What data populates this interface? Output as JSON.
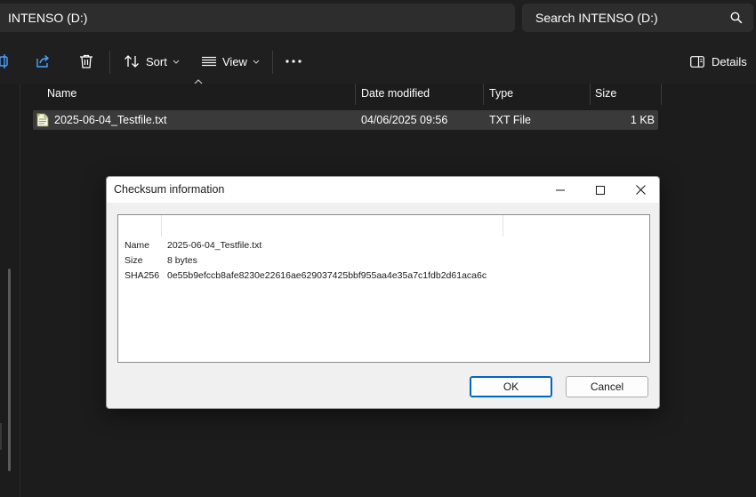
{
  "address": {
    "path": "INTENSO (D:)"
  },
  "search": {
    "placeholder": "Search INTENSO (D:)"
  },
  "toolbar": {
    "sort_label": "Sort",
    "view_label": "View",
    "details_label": "Details"
  },
  "columns": {
    "name": "Name",
    "date_modified": "Date modified",
    "type": "Type",
    "size": "Size"
  },
  "files": [
    {
      "name": "2025-06-04_Testfile.txt",
      "date_modified": "04/06/2025 09:56",
      "type": "TXT File",
      "size": "1 KB"
    }
  ],
  "dialog": {
    "title": "Checksum information",
    "fields": {
      "name_label": "Name",
      "name_value": "2025-06-04_Testfile.txt",
      "size_label": "Size",
      "size_value": "8 bytes",
      "hash_label": "SHA256",
      "hash_value": "0e55b9efccb8afe8230e22616ae629037425bbf955aa4e35a7c1fdb2d61aca6c"
    },
    "ok_label": "OK",
    "cancel_label": "Cancel"
  },
  "icons": {
    "search": "search-icon",
    "share": "share-icon",
    "delete": "trash-icon",
    "sort": "sort-icon",
    "view": "view-lines-icon",
    "more": "more-icon",
    "details": "details-pane-icon",
    "file": "text-file-icon"
  },
  "colors": {
    "background": "#1c1c1c",
    "selected_row": "#3a3a3a",
    "dialog_bg": "#f0f0f0",
    "accent": "#0067c0"
  }
}
